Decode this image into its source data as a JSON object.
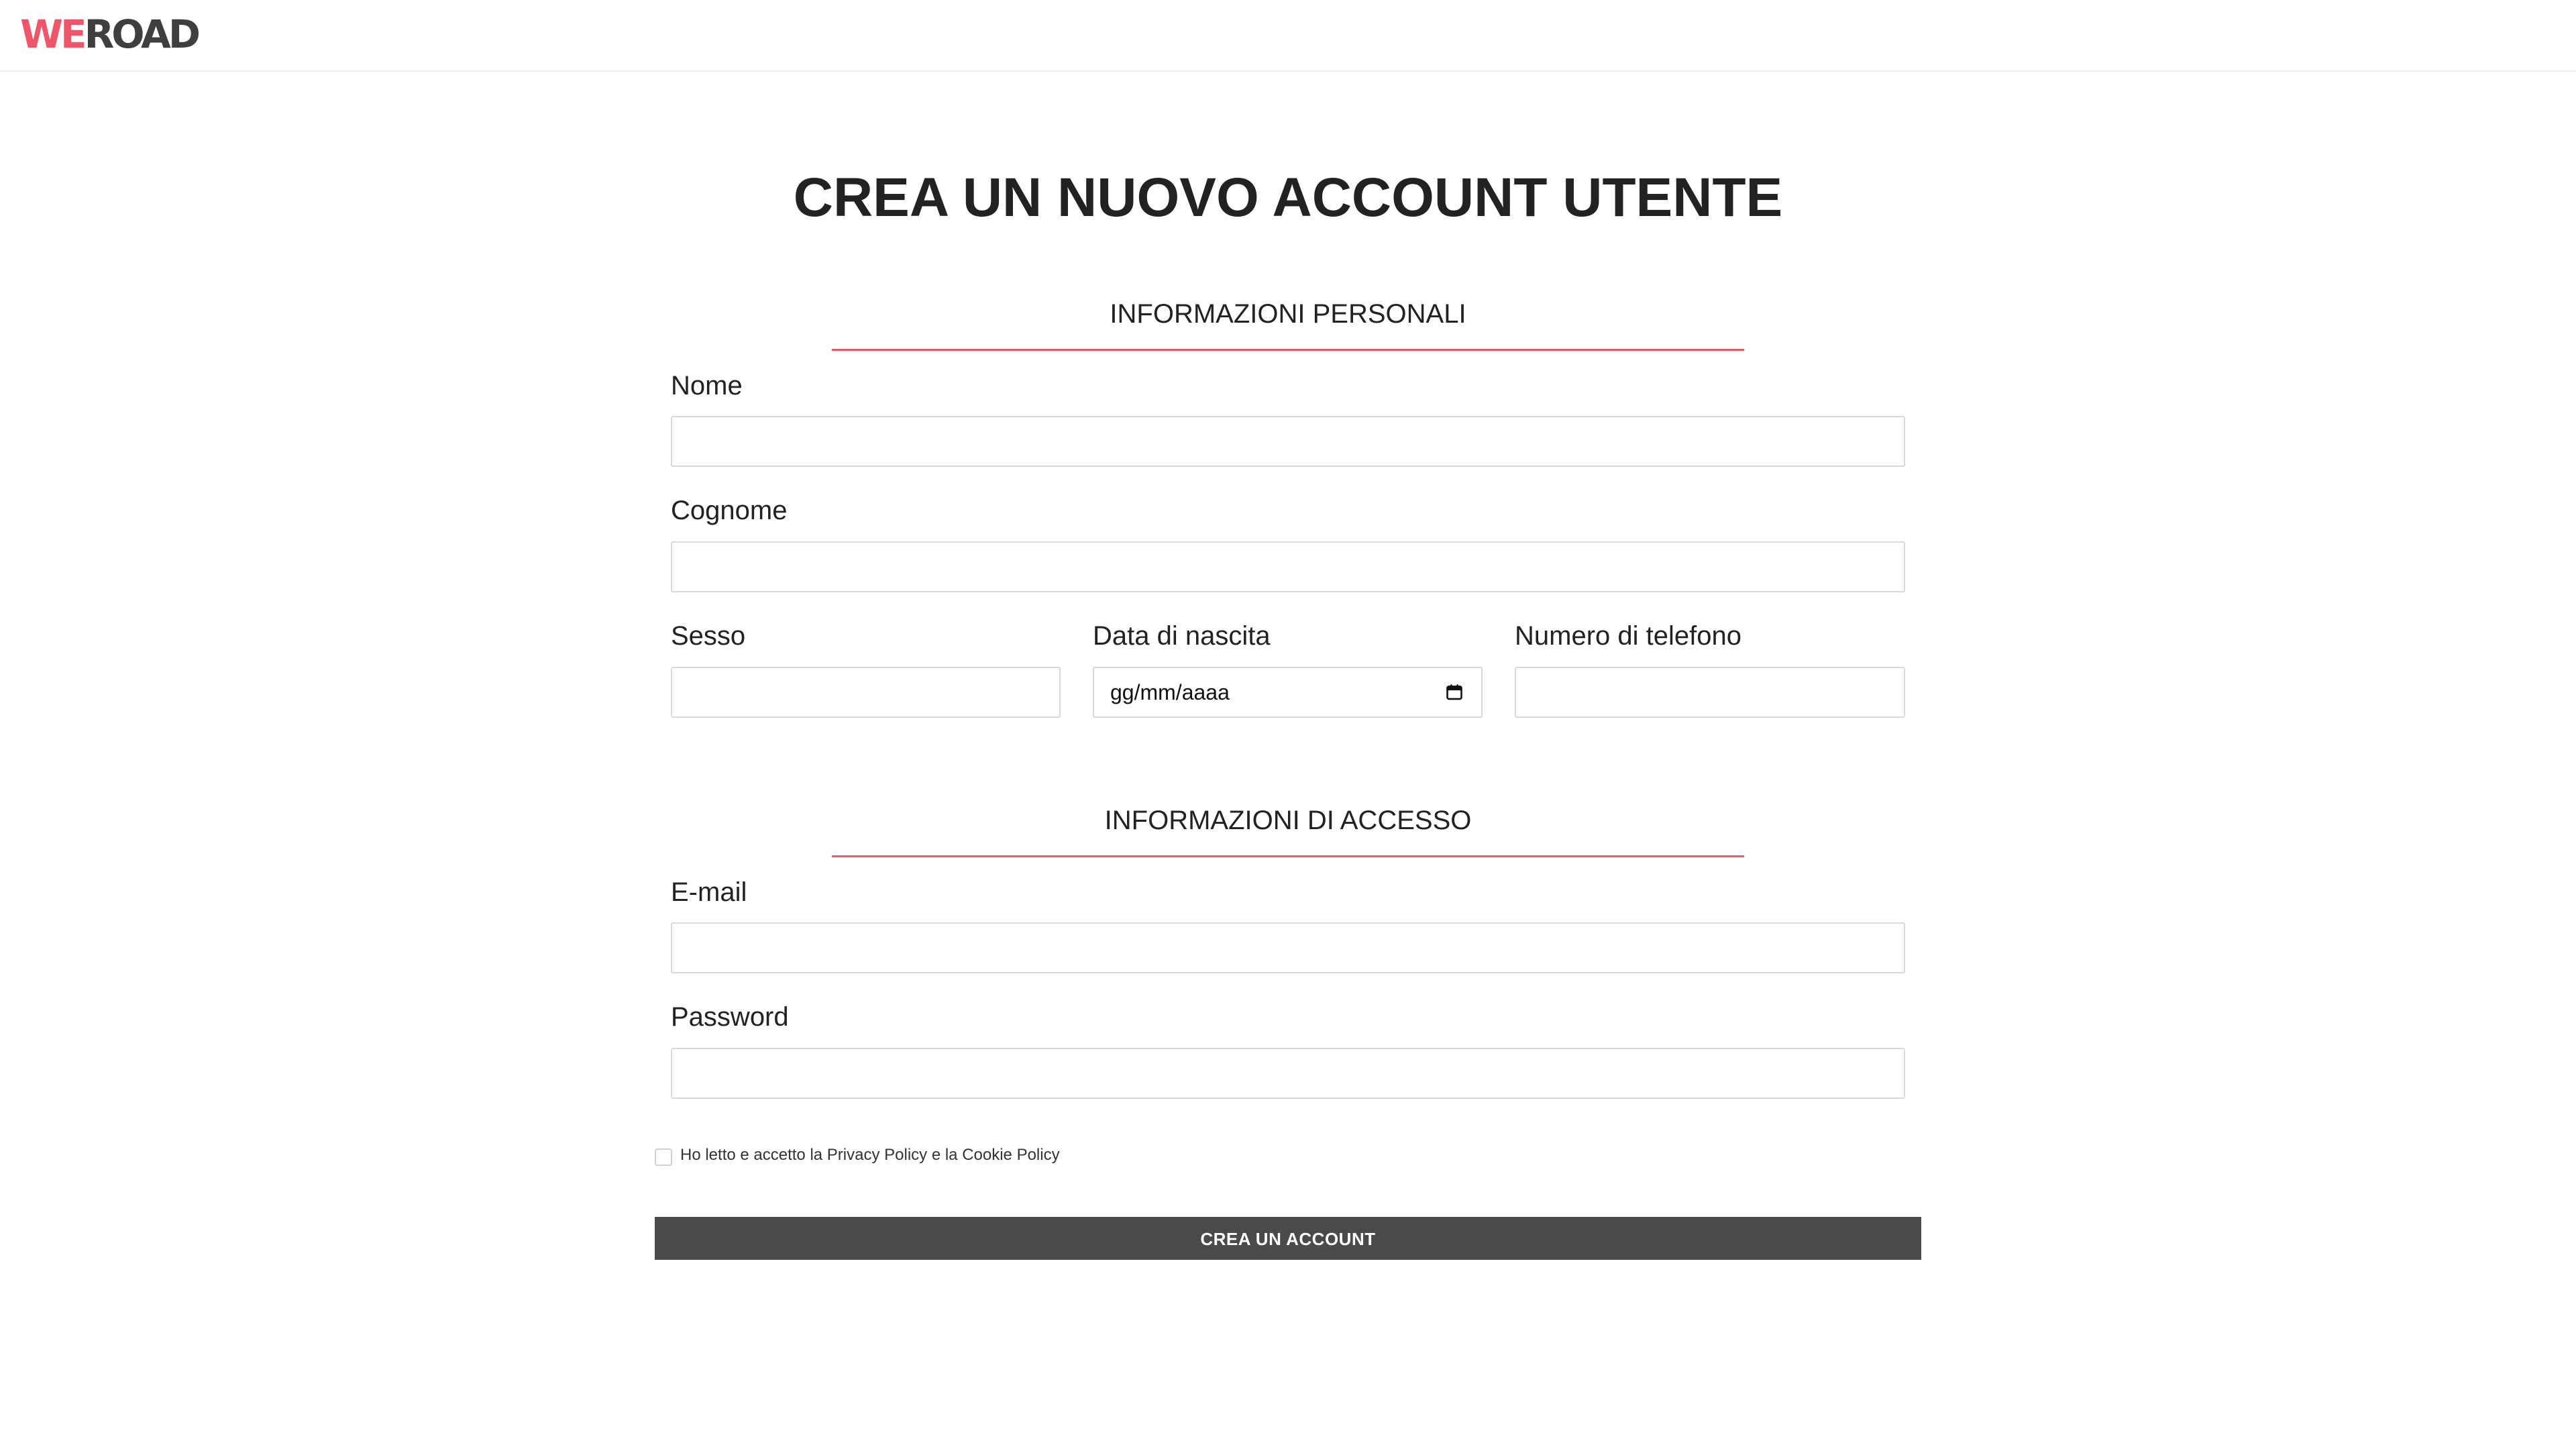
{
  "header": {
    "logo_we": "WE",
    "logo_road": "ROAD"
  },
  "page_title": "CREA UN NUOVO ACCOUNT UTENTE",
  "personal_section": {
    "title": "INFORMAZIONI PERSONALI",
    "nome_label": "Nome",
    "nome_value": "",
    "cognome_label": "Cognome",
    "cognome_value": "",
    "sesso_label": "Sesso",
    "sesso_value": "",
    "data_label": "Data di nascita",
    "data_placeholder": "gg/mm/aaaa",
    "telefono_label": "Numero di telefono",
    "telefono_value": ""
  },
  "access_section": {
    "title": "INFORMAZIONI DI ACCESSO",
    "email_label": "E-mail",
    "email_value": "",
    "password_label": "Password",
    "password_value": ""
  },
  "consent": {
    "text": "Ho letto e accetto la Privacy Policy e la Cookie Policy",
    "checked": false
  },
  "submit_label": "CREA UN ACCOUNT",
  "colors": {
    "accent": "#f0566a",
    "button_bg": "#4a4a4a",
    "text": "#222222",
    "input_border": "#d9d9d9"
  },
  "icons": {
    "date": "calendar-icon"
  }
}
